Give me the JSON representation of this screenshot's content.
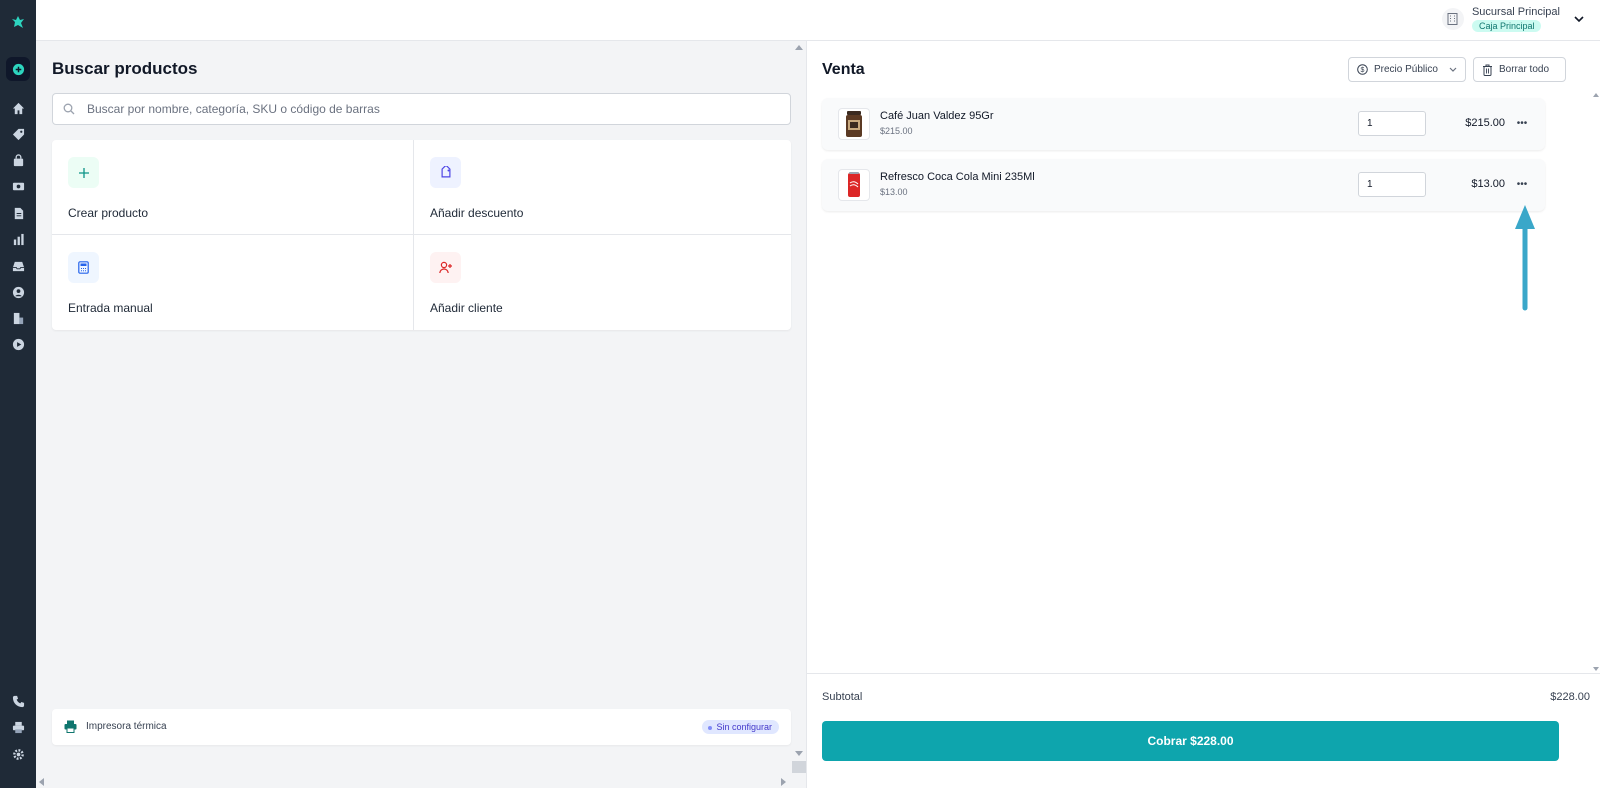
{
  "branch": {
    "name": "Sucursal Principal",
    "register": "Caja Principal"
  },
  "left": {
    "title": "Buscar productos",
    "search_placeholder": "Buscar por nombre, categoría, SKU o código de barras",
    "actions": [
      {
        "label": "Crear producto",
        "icon": "plus-icon"
      },
      {
        "label": "Añadir descuento",
        "icon": "tag-icon"
      },
      {
        "label": "Entrada manual",
        "icon": "calculator-icon"
      },
      {
        "label": "Añadir cliente",
        "icon": "user-plus-icon"
      }
    ],
    "printer": {
      "label": "Impresora térmica",
      "status": "Sin configurar"
    }
  },
  "sale": {
    "title": "Venta",
    "price_list": "Precio Público",
    "clear_all": "Borrar todo",
    "items": [
      {
        "name": "Café Juan Valdez 95Gr",
        "unit_price": "$215.00",
        "qty": "1",
        "total": "$215.00"
      },
      {
        "name": "Refresco Coca Cola Mini 235Ml",
        "unit_price": "$13.00",
        "qty": "1",
        "total": "$13.00"
      }
    ],
    "subtotal_label": "Subtotal",
    "subtotal_value": "$228.00",
    "pay_label": "Cobrar $228.00",
    "more_icon": "ellipsis-icon"
  },
  "colors": {
    "accent": "#0ea5ad",
    "sidebar": "#1f2a37",
    "annotation": "#3aa7c9"
  }
}
